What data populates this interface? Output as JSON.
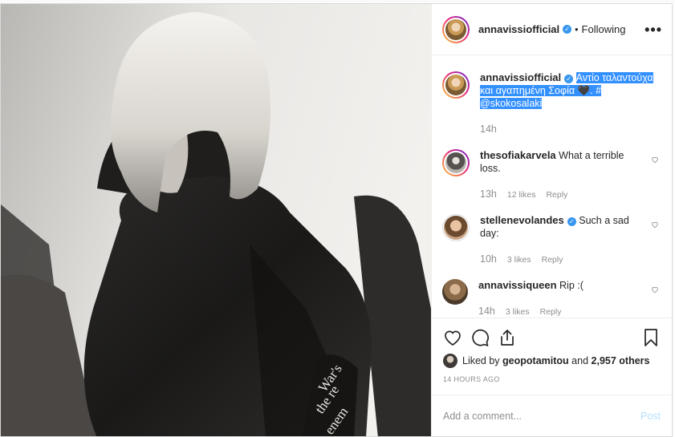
{
  "header": {
    "username": "annavissiofficial",
    "separator": "•",
    "follow_status": "Following",
    "more_label": "•••"
  },
  "caption": {
    "username": "annavissiofficial",
    "text": "Αντίο ταλαντούχα και αγαπημένη Σοφία 🖤. # @skokosalaki",
    "time": "14h"
  },
  "comments": [
    {
      "username": "thesofiakarvela",
      "verified": false,
      "text": "What a terrible loss.",
      "time": "13h",
      "likes": "12 likes",
      "reply": "Reply"
    },
    {
      "username": "stellenevolandes",
      "verified": true,
      "text": "Such a sad day:",
      "time": "10h",
      "likes": "3 likes",
      "reply": "Reply"
    },
    {
      "username": "annavissiqueen",
      "verified": false,
      "text": "Rip :(",
      "time": "14h",
      "likes": "3 likes",
      "reply": "Reply"
    }
  ],
  "likes": {
    "prefix": "Liked by",
    "user": "geopotamitou",
    "joiner": "and",
    "others": "2,957 others"
  },
  "posted_time": "14 HOURS AGO",
  "add_comment": {
    "placeholder": "Add a comment...",
    "post_label": "Post"
  },
  "photo": {
    "sleeve_text_lines": [
      "War's",
      "the re",
      "enem"
    ]
  },
  "icons": {
    "like": "heart-icon",
    "comment": "comment-icon",
    "share": "share-icon",
    "save": "bookmark-icon",
    "verified": "verified-badge-icon"
  },
  "colors": {
    "link_blue": "#3897f0",
    "selection": "#3390ff",
    "post_disabled": "#b2dffc",
    "muted": "#8e8e8e"
  }
}
